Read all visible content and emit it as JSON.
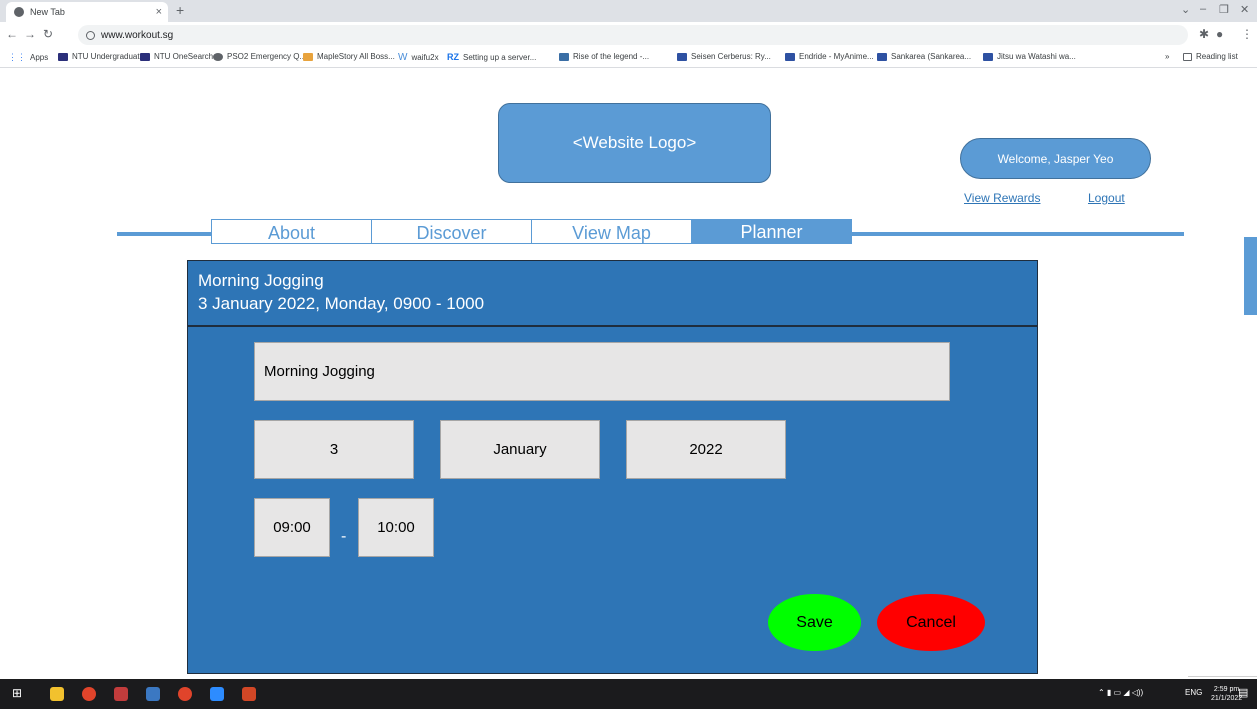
{
  "browser": {
    "tab_title": "New Tab",
    "tab_close": "×",
    "new_tab": "+",
    "url": "www.workout.sg",
    "bookmarks": [
      "Apps",
      "NTU Undergraduat...",
      "NTU OneSearch",
      "PSO2 Emergency Q...",
      "MapleStory All Boss...",
      "waifu2x",
      "Setting up a server...",
      "Rise of the legend -...",
      "Seisen Cerberus: Ry...",
      "Endride - MyAnime...",
      "Sankarea (Sankarea...",
      "Jitsu wa Watashi wa..."
    ],
    "more": "»",
    "reading_list": "Reading list"
  },
  "header": {
    "logo": "<Website Logo>",
    "welcome": "Welcome, Jasper Yeo",
    "view_rewards": "View Rewards",
    "logout": "Logout"
  },
  "nav": {
    "tabs": [
      "About",
      "Discover",
      "View Map",
      "Planner"
    ],
    "active": "Planner"
  },
  "planner": {
    "title": "Morning Jogging",
    "subtitle": "3 January 2022, Monday, 0900 - 1000",
    "name_value": "Morning Jogging",
    "day": "3",
    "month": "January",
    "year": "2022",
    "start_time": "09:00",
    "separator": "-",
    "end_time": "10:00",
    "save": "Save",
    "cancel": "Cancel"
  },
  "taskbar": {
    "lang": "ENG",
    "time": "2:59 pm",
    "date": "21/1/2022"
  },
  "colors": {
    "panel": "#2e75b6",
    "accent": "#5b9bd5",
    "save": "#00ff00",
    "cancel": "#ff0000"
  }
}
